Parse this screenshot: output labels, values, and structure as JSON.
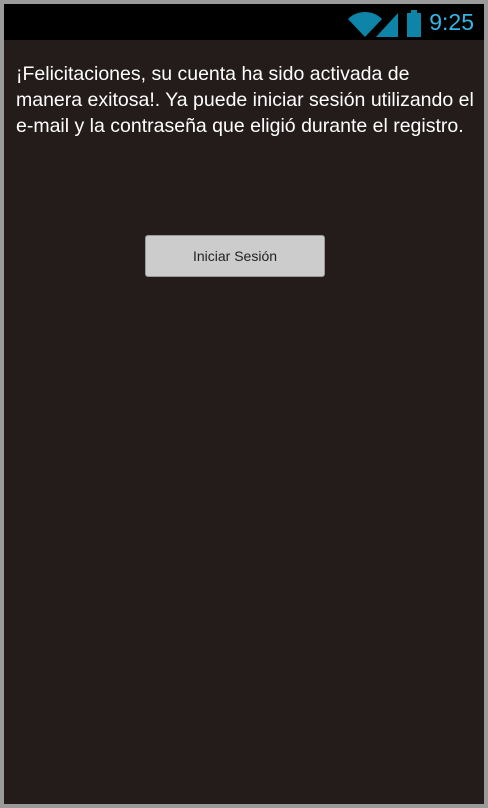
{
  "status_bar": {
    "time": "9:25",
    "icons": [
      "wifi-icon",
      "signal-icon",
      "battery-icon"
    ],
    "accent": "#33b5e5"
  },
  "main": {
    "message": "¡Felicitaciones, su cuenta ha sido activada de manera exitosa!. Ya puede iniciar sesión utilizando el e-mail y la contraseña que eligió durante el registro.",
    "login_button": "Iniciar Sesión"
  }
}
